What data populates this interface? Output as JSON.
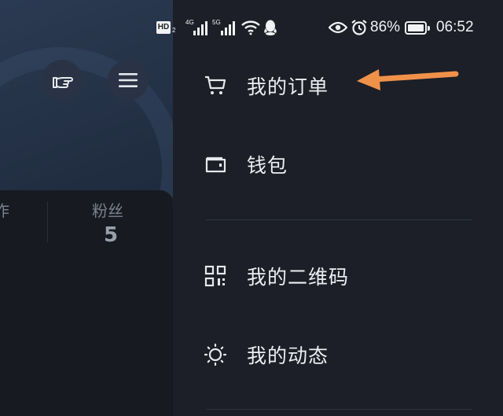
{
  "status_bar": {
    "hd": "HD",
    "sim_index": "2",
    "net1": "4G",
    "net2": "5G",
    "battery_percent": "86%",
    "time": "06:52",
    "icons": [
      "signal-icon",
      "wifi-icon",
      "qq-icon",
      "eye-icon",
      "alarm-icon",
      "battery-icon"
    ]
  },
  "profile": {
    "stats": [
      {
        "label": "作",
        "value": ""
      },
      {
        "label": "粉丝",
        "value": "5"
      }
    ]
  },
  "menu": {
    "items": [
      {
        "label": "我的订单",
        "icon": "cart-icon"
      },
      {
        "label": "钱包",
        "icon": "wallet-icon"
      },
      {
        "label": "我的二维码",
        "icon": "qr-code-icon"
      },
      {
        "label": "我的动态",
        "icon": "sun-icon"
      }
    ]
  },
  "colors": {
    "panel_bg": "#1c1f27",
    "arrow": "#f0914a",
    "text": "#eceef2"
  }
}
